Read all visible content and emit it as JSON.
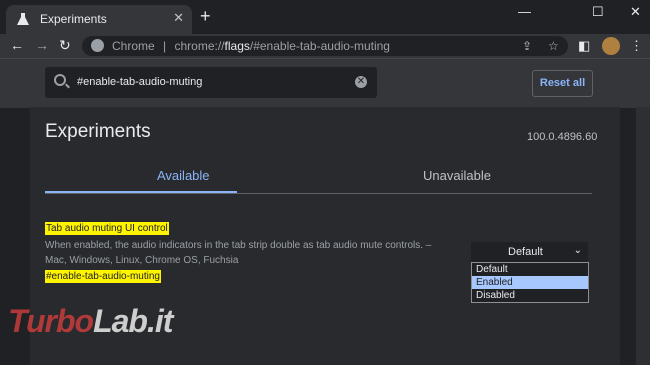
{
  "browser": {
    "tab_title": "Experiments",
    "tab_close": "✕",
    "new_tab": "+",
    "window_controls": [
      "—",
      "☐",
      "✕"
    ],
    "nav": {
      "back": "←",
      "forward": "→",
      "reload": "↻"
    },
    "address": {
      "brand": "Chrome",
      "sep": "|",
      "scheme": "chrome://",
      "host": "flags",
      "path": "/#enable-tab-audio-muting"
    },
    "toolbar_icons": {
      "share": "⇪",
      "bookmark": "☆",
      "sidepanel": "◧",
      "menu": "⋮"
    }
  },
  "header": {
    "search_value": "#enable-tab-audio-muting",
    "reset_label": "Reset all"
  },
  "page": {
    "title": "Experiments",
    "version": "100.0.4896.60",
    "tabs": [
      {
        "label": "Available"
      },
      {
        "label": "Unavailable"
      }
    ],
    "flag": {
      "name": "Tab audio muting UI control",
      "description": "When enabled, the audio indicators in the tab strip double as tab audio mute controls. – Mac, Windows, Linux, Chrome OS, Fuchsia",
      "hash": "#enable-tab-audio-muting",
      "selected": "Default",
      "options": [
        {
          "label": "Default"
        },
        {
          "label": "Enabled"
        },
        {
          "label": "Disabled"
        }
      ],
      "highlighted_option": "Enabled"
    }
  },
  "watermark": {
    "part1": "Turbo",
    "part2": "Lab.it"
  },
  "colors": {
    "accent": "#8ab4f8",
    "highlight": "#fff400",
    "background": "#202124"
  }
}
